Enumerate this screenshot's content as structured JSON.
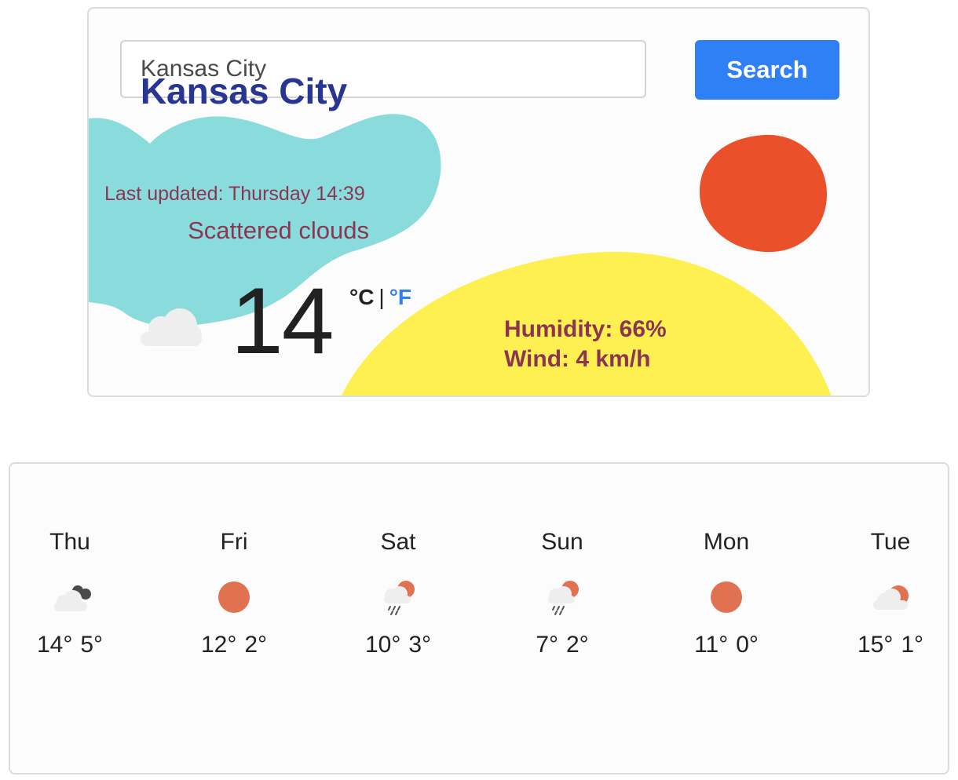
{
  "search": {
    "value": "Kansas City",
    "button_label": "Search"
  },
  "current": {
    "city": "Kansas City",
    "last_updated": "Last updated: Thursday 14:39",
    "description": "Scattered clouds",
    "temperature": "14",
    "unit_celsius": "°C",
    "unit_separator": "|",
    "unit_fahrenheit": "°F",
    "humidity": "Humidity: 66%",
    "wind": "Wind: 4 km/h"
  },
  "forecast": [
    {
      "day": "Thu",
      "icon": "cloudy-icon",
      "high": "14°",
      "low": "5°"
    },
    {
      "day": "Fri",
      "icon": "sun-icon",
      "high": "12°",
      "low": "2°"
    },
    {
      "day": "Sat",
      "icon": "rain-sun-icon",
      "high": "10°",
      "low": "3°"
    },
    {
      "day": "Sun",
      "icon": "rain-sun-icon",
      "high": "7°",
      "low": "2°"
    },
    {
      "day": "Mon",
      "icon": "sun-icon",
      "high": "11°",
      "low": "0°"
    },
    {
      "day": "Tue",
      "icon": "partly-cloudy-icon",
      "high": "15°",
      "low": "1°"
    }
  ],
  "colors": {
    "accent": "#2f7ff5",
    "city": "#283593",
    "text_secondary": "#8c3552",
    "blob_teal": "#8adcdc",
    "blob_yellow": "#fff052",
    "sun_orange": "#ea512b",
    "forecast_sun": "#e07252"
  }
}
